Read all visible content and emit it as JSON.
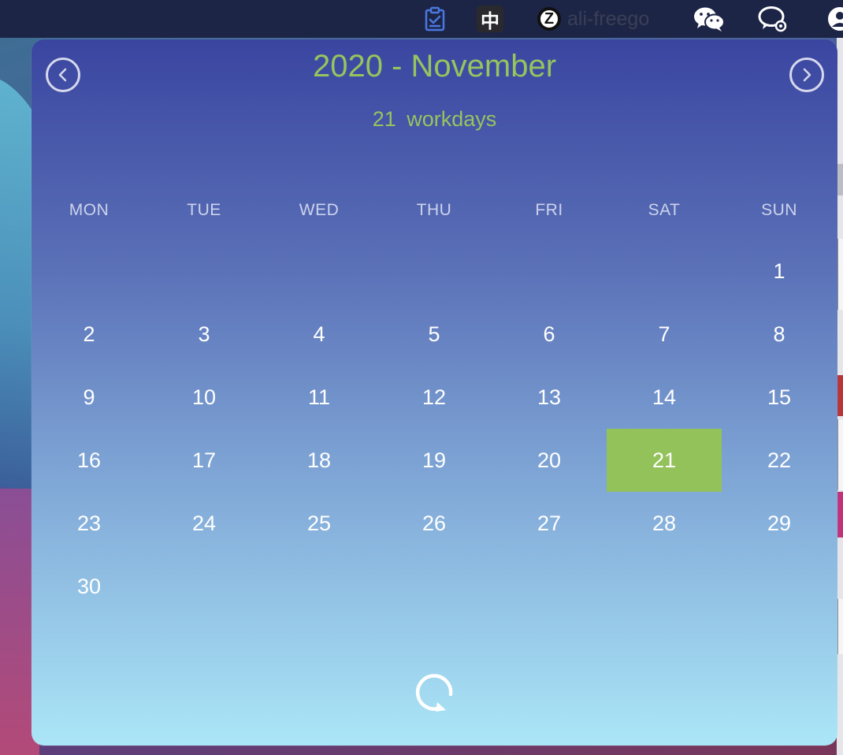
{
  "menubar": {
    "zh_label": "中",
    "app_label": "ali-freego",
    "app_icon_letter": "Z"
  },
  "calendar": {
    "title": "2020 - November",
    "workdays_count": "21",
    "workdays_label": "workdays",
    "weekdays": [
      "MON",
      "TUE",
      "WED",
      "THU",
      "FRI",
      "SAT",
      "SUN"
    ],
    "first_weekday_index": 6,
    "days_in_month": 30,
    "today": 21,
    "today_color": "#93c25a",
    "title_color": "#96c45e"
  }
}
